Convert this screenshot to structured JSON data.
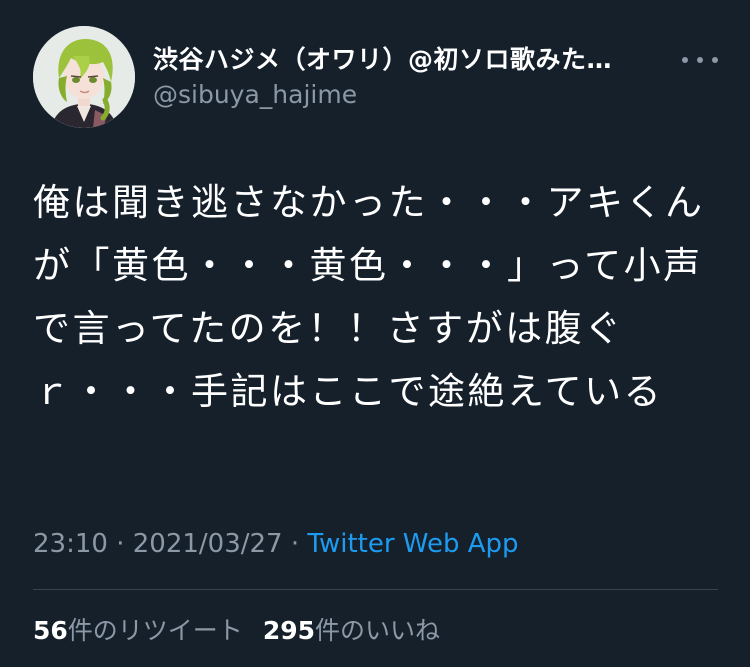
{
  "author": {
    "display_name": "渋谷ハジメ（オワリ）@初ソロ歌みた…",
    "handle": "@sibuya_hajime",
    "avatar_icon": "avatar-green-hair-character"
  },
  "more_icon": "more-horizontal-icon",
  "tweet": {
    "text": "俺は聞き逃さなかった・・・アキくんが「黄色・・・黄色・・・」って小声で言ってたのを！！さすがは腹ぐｒ・・・手記はここで途絶えている"
  },
  "meta": {
    "time": "23:10",
    "date": "2021/03/27",
    "separator": "·",
    "source": "Twitter Web App"
  },
  "stats": {
    "retweets_count": "56",
    "retweets_label": "件のリツイート",
    "likes_count": "295",
    "likes_label": "件のいいね"
  },
  "colors": {
    "background": "#15202b",
    "secondary_text": "#8b98a5",
    "link": "#1d9bf0",
    "divider": "#38444d"
  }
}
